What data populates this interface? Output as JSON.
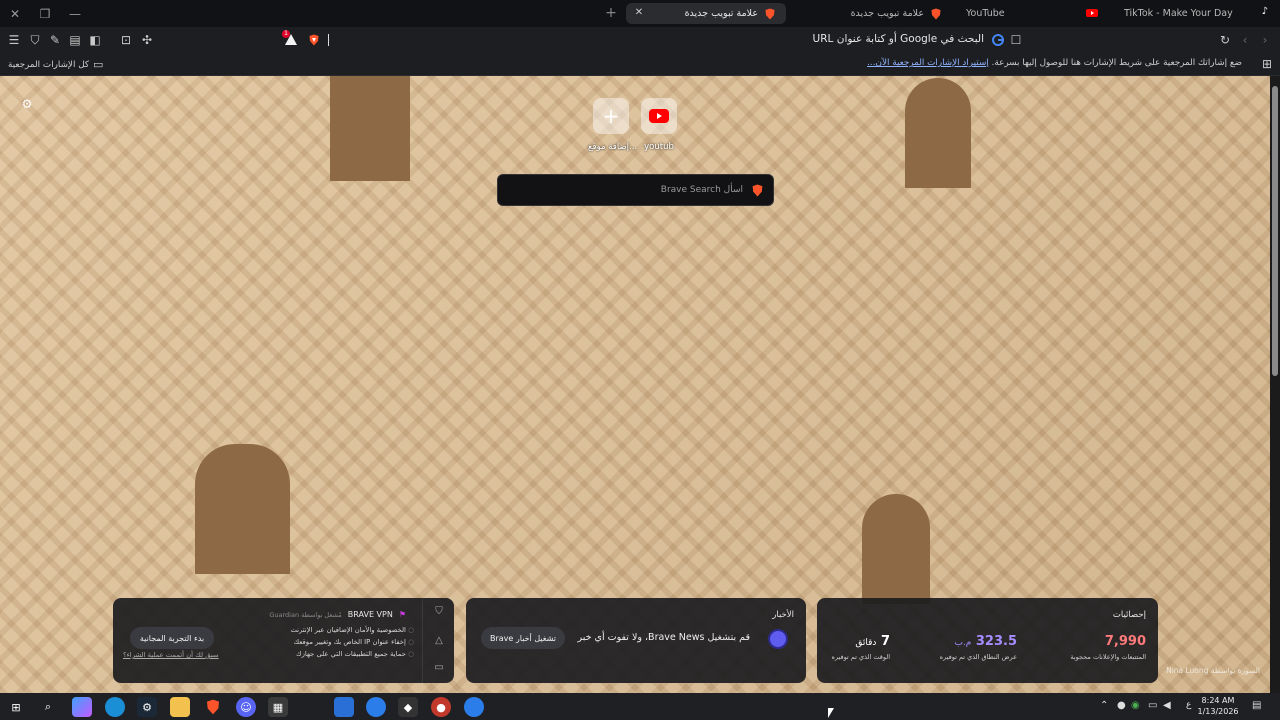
{
  "tabs": [
    {
      "title": "علامة تبويب جديدة",
      "active": true
    },
    {
      "title": "علامة تبويب جديدة",
      "active": false
    },
    {
      "title": "YouTube",
      "active": false
    },
    {
      "title": "TikTok - Make Your Day",
      "active": false
    }
  ],
  "toolbar": {
    "url_placeholder": "البحث في Google أو كتابة عنوان URL",
    "shields_badge": "1"
  },
  "bookmarks_bar": {
    "hint": "ضع إشاراتك المرجعية على شريط الإشارات هنا للوصول إليها بسرعة.",
    "import_link": "إستيراد الإشارات المرجعية الآن...",
    "all_bookmarks": "كل الإشارات المرجعية"
  },
  "new_tab": {
    "top_sites": [
      {
        "label": "youtub",
        "icon": "youtube-icon"
      },
      {
        "label": "إضافة موقع...",
        "icon": "plus-icon"
      }
    ],
    "search_placeholder": "اسأل Brave Search",
    "photo_credit": "الصورة بواسطة Nina Luong"
  },
  "stats_widget": {
    "title": "إحصائيات",
    "items": [
      {
        "value": "7,990",
        "caption": "المتتبعات والإعلانات محجوبة",
        "color": "#ff7a7a"
      },
      {
        "value": "323.5",
        "unit": "م.ب",
        "caption": "عرض النطاق الذي تم توفيره",
        "color": "#a58cff"
      },
      {
        "value": "7",
        "unit": "دقائق",
        "caption": "الوقت الذي تم توفيره",
        "color": "#ffffff"
      }
    ]
  },
  "news_widget": {
    "title": "الأخبار",
    "text": "قم بتشغيل Brave News، ولا تفوت أي خبر",
    "button": "تشغيل أخبار Brave"
  },
  "vpn_widget": {
    "title": "BRAVE VPN",
    "powered_by": "مُشغل بواسطة Guardian",
    "features": [
      "الخصوصية والأمان الإضافيان عبر الإنترنت",
      "إخفاء عنوان IP الخاص بك وتغيير موقعك",
      "حماية جميع التطبيقات التي على جهازك"
    ],
    "cta": "بدء التجربة المجانية",
    "restore_link": "سبق لك أن أتممت عملية الشراء؟"
  },
  "taskbar": {
    "time": "8:24 AM",
    "date": "1/13/2026",
    "lang": "ع"
  },
  "colors": {
    "brave_orange": "#fb542b",
    "youtube_red": "#ff0000",
    "stat_red": "#ff7a7a",
    "stat_purple": "#a58cff"
  }
}
